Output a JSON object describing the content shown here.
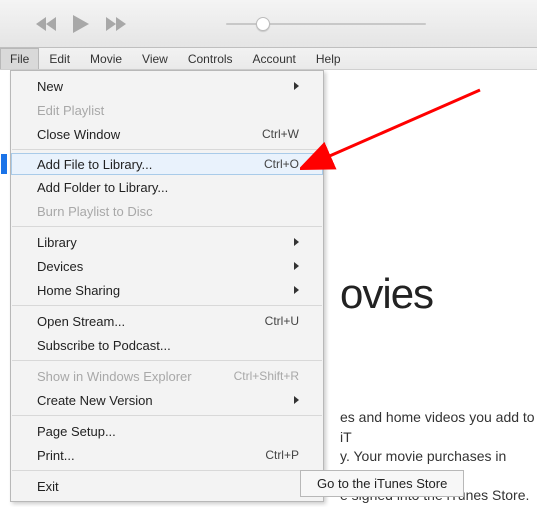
{
  "menubar": {
    "items": [
      "File",
      "Edit",
      "Movie",
      "View",
      "Controls",
      "Account",
      "Help"
    ],
    "active_index": 0
  },
  "dropdown": {
    "items": [
      {
        "label": "New",
        "submenu": true
      },
      {
        "label": "Edit Playlist",
        "disabled": true
      },
      {
        "label": "Close Window",
        "shortcut": "Ctrl+W"
      },
      {
        "sep": true
      },
      {
        "label": "Add File to Library...",
        "shortcut": "Ctrl+O",
        "highlight": true
      },
      {
        "label": "Add Folder to Library..."
      },
      {
        "label": "Burn Playlist to Disc",
        "disabled": true
      },
      {
        "sep": true
      },
      {
        "label": "Library",
        "submenu": true
      },
      {
        "label": "Devices",
        "submenu": true
      },
      {
        "label": "Home Sharing",
        "submenu": true
      },
      {
        "sep": true
      },
      {
        "label": "Open Stream...",
        "shortcut": "Ctrl+U"
      },
      {
        "label": "Subscribe to Podcast..."
      },
      {
        "sep": true
      },
      {
        "label": "Show in Windows Explorer",
        "shortcut": "Ctrl+Shift+R",
        "disabled": true
      },
      {
        "label": "Create New Version",
        "submenu": true
      },
      {
        "sep": true
      },
      {
        "label": "Page Setup..."
      },
      {
        "label": "Print...",
        "shortcut": "Ctrl+P"
      },
      {
        "sep": true
      },
      {
        "label": "Exit"
      }
    ]
  },
  "content": {
    "heading": "ovies",
    "line1": "es and home videos you add to iT",
    "line2": "y. Your movie purchases in iCloud",
    "line3": "e signed into the iTunes Store."
  },
  "store_button": "Go to the iTunes Store"
}
